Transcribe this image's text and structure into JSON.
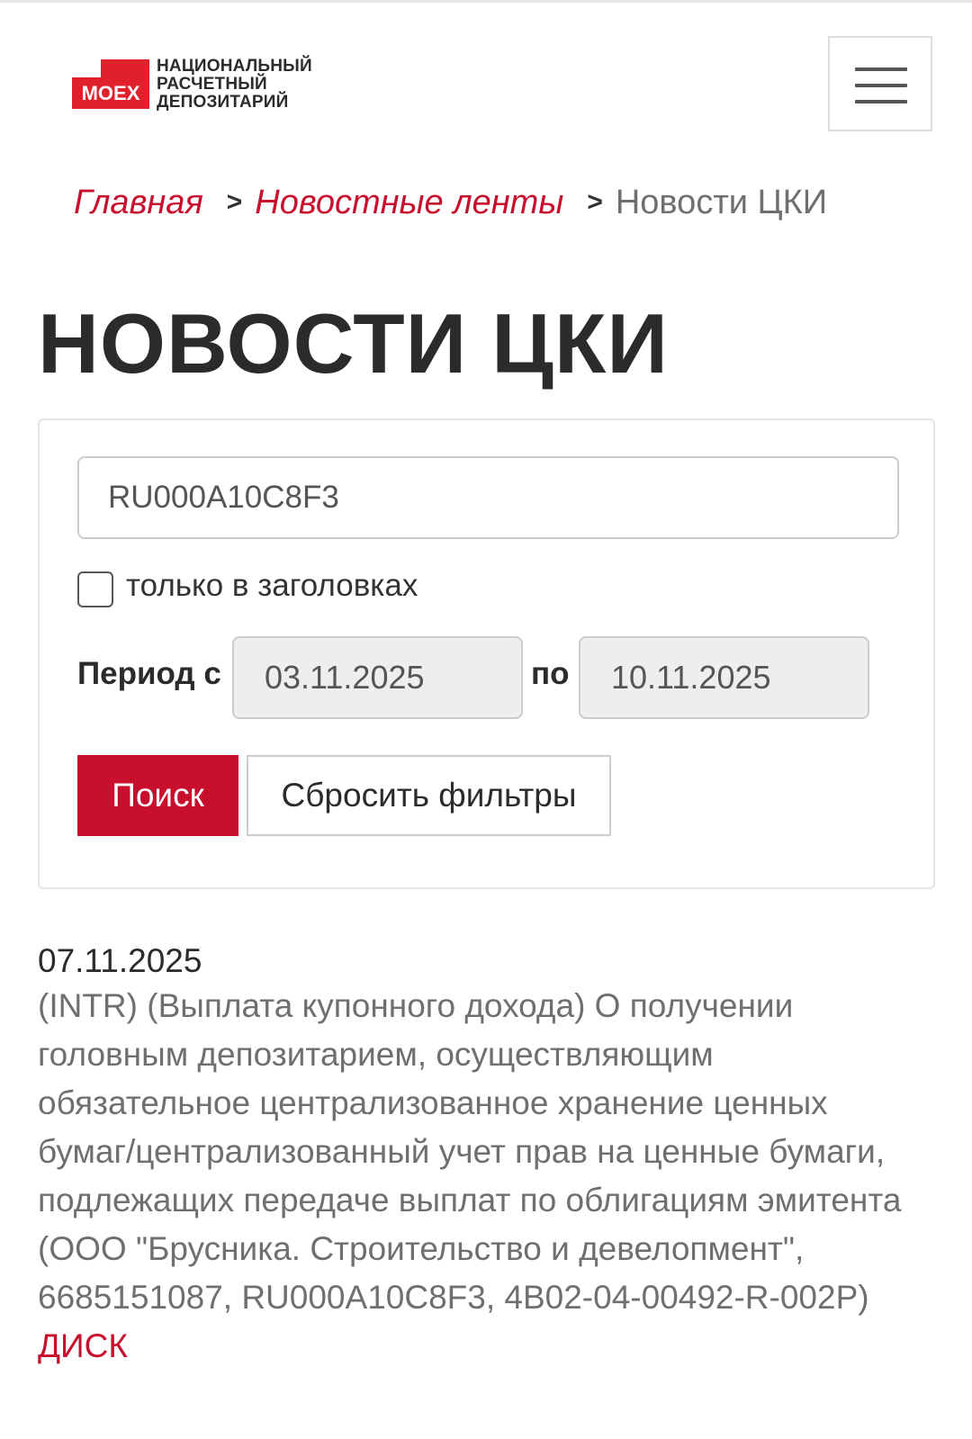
{
  "header": {
    "logo_mark": "MOEX",
    "logo_lines": [
      "НАЦИОНАЛЬНЫЙ",
      "РАСЧЕТНЫЙ",
      "ДЕПОЗИТАРИЙ"
    ],
    "menu_icon": "hamburger-menu-icon"
  },
  "breadcrumb": {
    "items": [
      "Главная",
      "Новостные ленты"
    ],
    "separator": ">",
    "current": "Новости ЦКИ"
  },
  "page_title": "НОВОСТИ ЦКИ",
  "filters": {
    "search_value": "RU000A10C8F3",
    "only_headlines_label": "только в заголовках",
    "only_headlines_checked": false,
    "period_from_label": "Период с",
    "period_from": "03.11.2025",
    "period_to_label": "по",
    "period_to": "10.11.2025",
    "search_button": "Поиск",
    "reset_button": "Сбросить фильтры"
  },
  "news": [
    {
      "date": "07.11.2025",
      "text": "(INTR) (Выплата купонного дохода) О получении головным депозитарием, осуществляющим обязательное централизованное хранение ценных бумаг/централизованный учет прав на ценные бумаги, подлежащих передаче выплат по облигациям эмитента (ООО \"Брусника. Строительство и девелопмент\", 6685151087, RU000A10C8F3, 4B02-04-00492-R-002P)",
      "tag": "ДИСК"
    }
  ],
  "colors": {
    "brand_red": "#c8102e",
    "logo_red": "#e0212b",
    "text_dark": "#2b2b2b",
    "text_muted": "#6f6f6f"
  }
}
